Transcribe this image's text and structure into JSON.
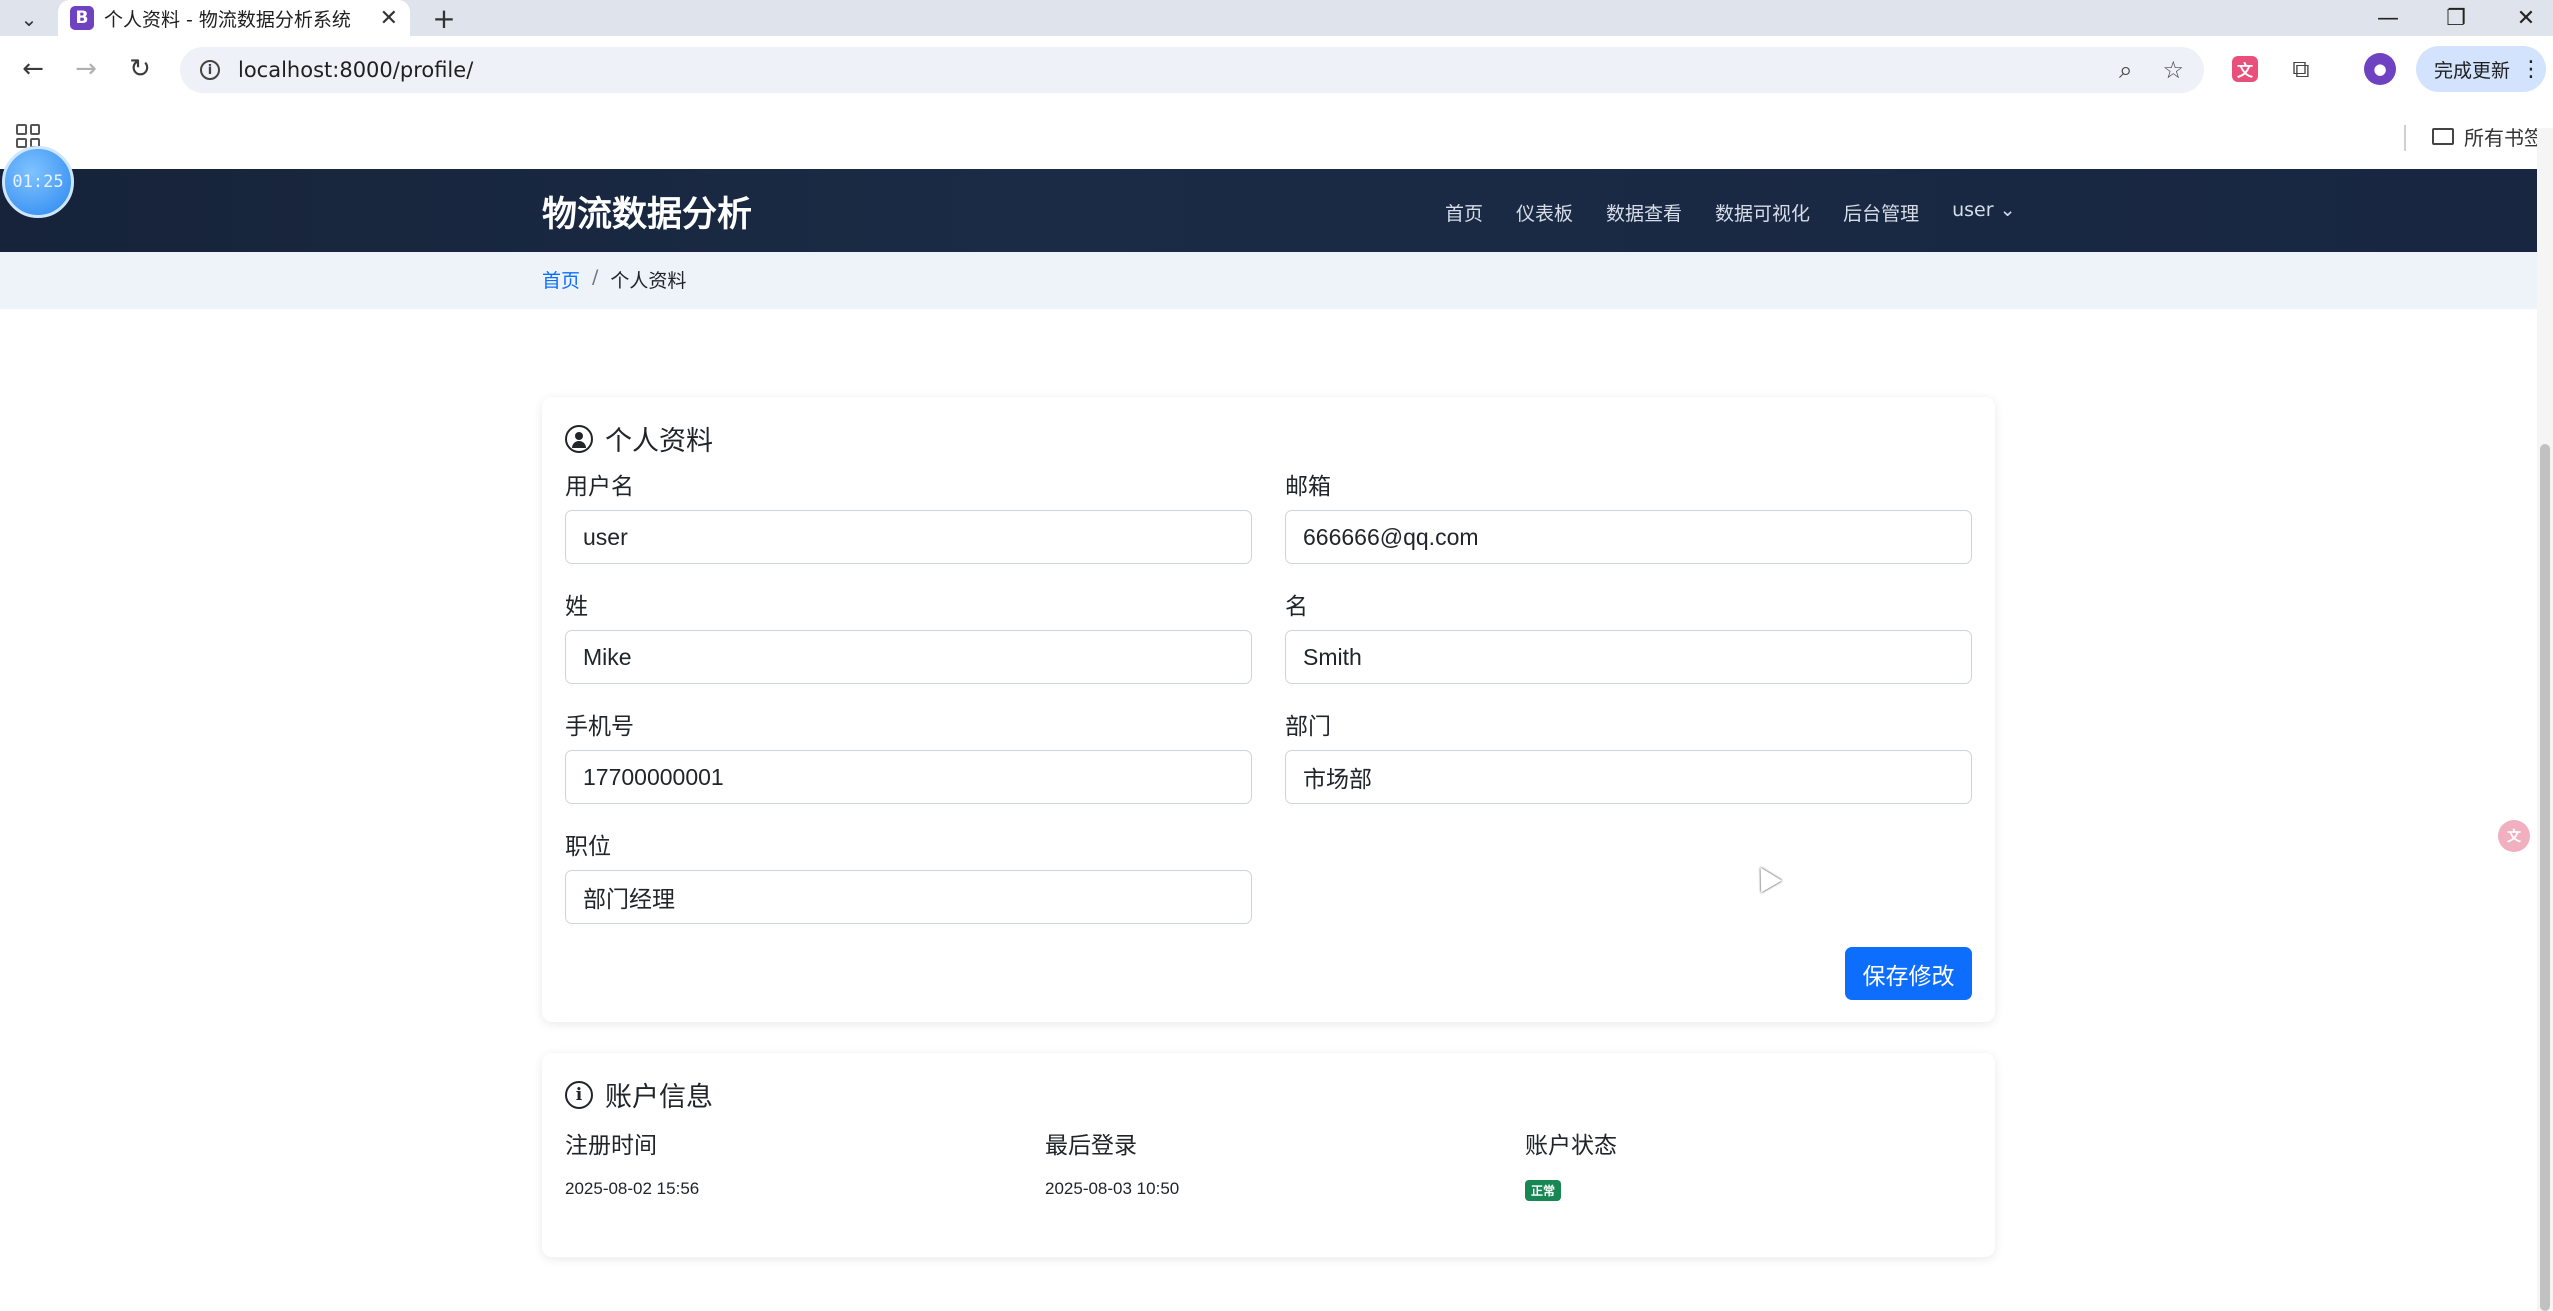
{
  "browser": {
    "tab_title": "个人资料 - 物流数据分析系统",
    "favicon_letter": "B",
    "url": "localhost:8000/profile/",
    "update_button": "完成更新",
    "bookmarks_all": "所有书签",
    "timer": "01:25"
  },
  "site": {
    "brand": "物流数据分析",
    "nav": [
      "首页",
      "仪表板",
      "数据查看",
      "数据可视化",
      "后台管理"
    ],
    "user_menu": "user"
  },
  "breadcrumb": {
    "home": "首页",
    "separator": "/",
    "current": "个人资料"
  },
  "profile": {
    "title": "个人资料",
    "fields": {
      "username": {
        "label": "用户名",
        "value": "user"
      },
      "email": {
        "label": "邮箱",
        "value": "666666@qq.com"
      },
      "last_name": {
        "label": "姓",
        "value": "Mike"
      },
      "first_name": {
        "label": "名",
        "value": "Smith"
      },
      "phone": {
        "label": "手机号",
        "value": "17700000001"
      },
      "department": {
        "label": "部门",
        "value": "市场部"
      },
      "position": {
        "label": "职位",
        "value": "部门经理"
      }
    },
    "save_button": "保存修改"
  },
  "account": {
    "title": "账户信息",
    "registered_label": "注册时间",
    "registered_value": "2025-08-02 15:56",
    "last_login_label": "最后登录",
    "last_login_value": "2025-08-03 10:50",
    "status_label": "账户状态",
    "status_value": "正常"
  },
  "colors": {
    "navbar": "#16233a",
    "primary": "#0d6efd",
    "status_success": "#198754"
  }
}
